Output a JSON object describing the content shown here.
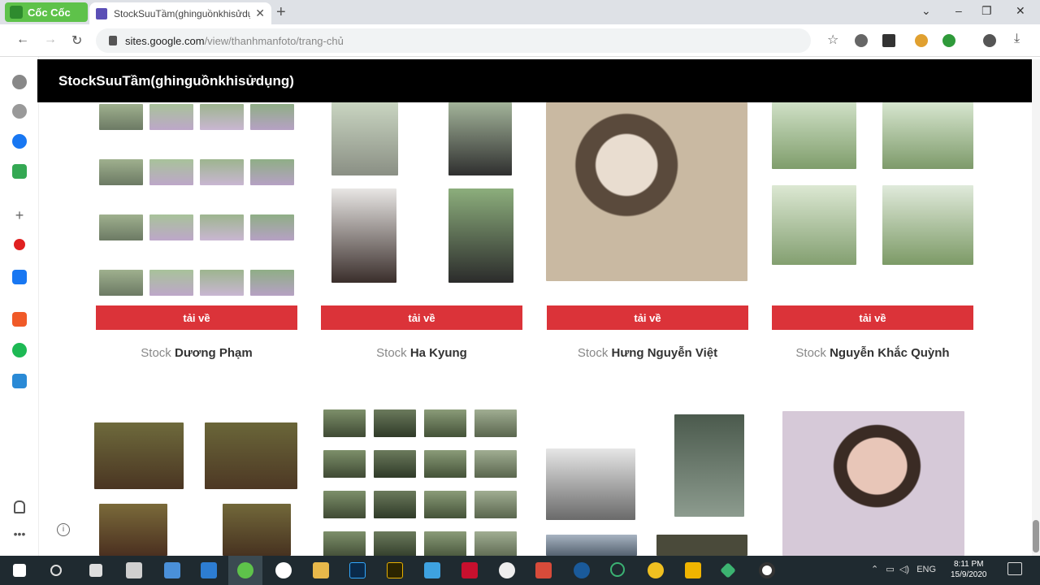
{
  "browser": {
    "brand_tab_label": "Cốc Cốc",
    "active_tab_title": "StockSuuTầm(ghinguồnkhisửdụng)",
    "url_host": "sites.google.com",
    "url_path": "/view/thanhmanfoto/trang-chủ"
  },
  "site": {
    "header_title": "StockSuuTầm(ghinguồnkhisửdụng)"
  },
  "stocks": [
    {
      "button": "tải về",
      "prefix": "Stock",
      "name": "Dương Phạm"
    },
    {
      "button": "tải về",
      "prefix": "Stock",
      "name": "Ha Kyung"
    },
    {
      "button": "tải về",
      "prefix": "Stock",
      "name": "Hưng Nguyễn Việt"
    },
    {
      "button": "tải về",
      "prefix": "Stock",
      "name": "Nguyễn Khắc Quỳnh"
    }
  ],
  "taskbar": {
    "time": "8:11 PM",
    "date": "15/9/2020",
    "lang": "ENG"
  },
  "colors": {
    "accent_red": "#db3339",
    "header_black": "#000000",
    "coccoc_green": "#5ec24a"
  },
  "icons": [
    "settings-icon",
    "history-icon",
    "messenger-icon",
    "game-icon",
    "add-icon",
    "youtube-icon",
    "facebook-icon",
    "notes-icon",
    "spotify-icon",
    "calculator-icon",
    "bell-icon",
    "more-icon"
  ]
}
